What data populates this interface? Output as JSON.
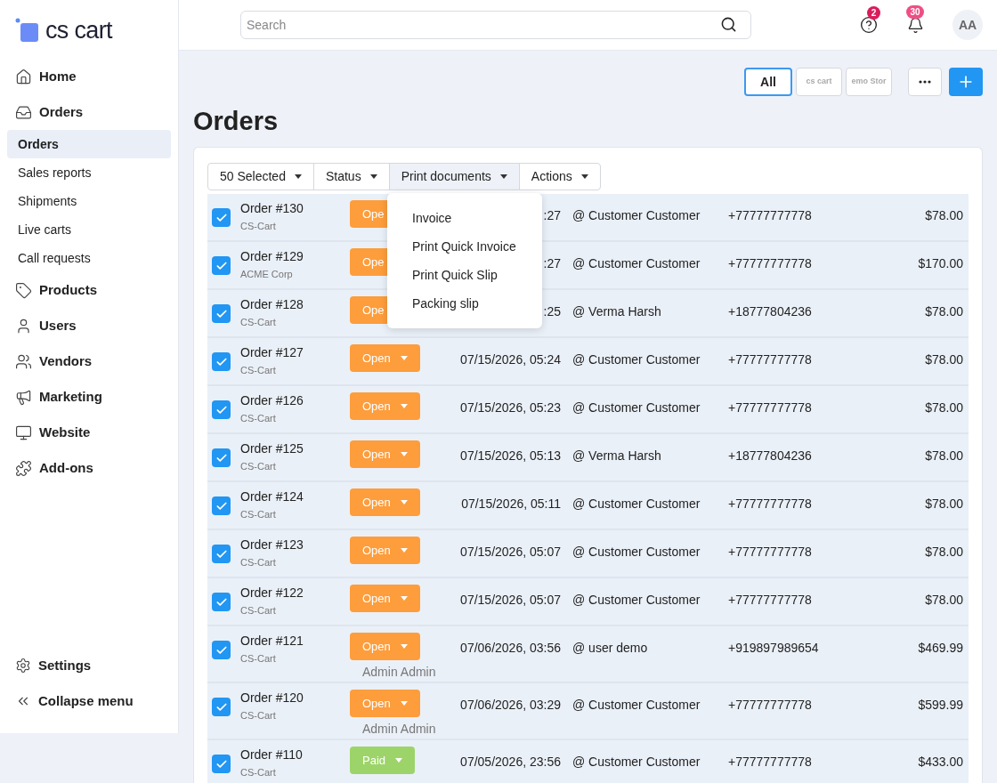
{
  "logo": {
    "text": "cs cart"
  },
  "sidebar": {
    "items": [
      {
        "label": "Home",
        "kind": "home"
      },
      {
        "label": "Orders",
        "kind": "orders",
        "children": [
          {
            "label": "Orders",
            "selected": true
          },
          {
            "label": "Sales reports",
            "selected": false
          },
          {
            "label": "Shipments",
            "selected": false
          },
          {
            "label": "Live carts",
            "selected": false
          },
          {
            "label": "Call requests",
            "selected": false
          }
        ]
      },
      {
        "label": "Products",
        "kind": "products"
      },
      {
        "label": "Users",
        "kind": "users"
      },
      {
        "label": "Vendors",
        "kind": "vendors"
      },
      {
        "label": "Marketing",
        "kind": "marketing"
      },
      {
        "label": "Website",
        "kind": "website"
      },
      {
        "label": "Add-ons",
        "kind": "addons"
      }
    ],
    "bottom": [
      {
        "label": "Settings",
        "kind": "settings"
      },
      {
        "label": "Collapse menu",
        "kind": "collapse"
      }
    ]
  },
  "header": {
    "search": {
      "placeholder": "Search"
    },
    "help_badge": "2",
    "notifications_badge": "30",
    "avatar": "AA"
  },
  "storefronts": [
    {
      "label": "All",
      "selected": true
    },
    {
      "label": "cs cart",
      "selected": false
    },
    {
      "label": "emo Stor",
      "selected": false
    }
  ],
  "page_title": "Orders",
  "toolbar": [
    {
      "label": "50 Selected",
      "open": false
    },
    {
      "label": "Status",
      "open": false
    },
    {
      "label": "Print documents",
      "open": true
    },
    {
      "label": "Actions",
      "open": false
    }
  ],
  "print_menu": [
    "Invoice",
    "Print Quick Invoice",
    "Print Quick Slip",
    "Packing slip"
  ],
  "orders": [
    {
      "order": "Order #130",
      "store": "CS-Cart",
      "status": "Ope",
      "kind": "open",
      "covered": true,
      "date": ":27",
      "customer": "@ Customer Customer",
      "phone": "+77777777778",
      "total": "$78.00",
      "checked": true
    },
    {
      "order": "Order #129",
      "store": "ACME Corp",
      "status": "Ope",
      "kind": "open",
      "covered": true,
      "date": ":27",
      "customer": "@ Customer Customer",
      "phone": "+77777777778",
      "total": "$170.00",
      "checked": true
    },
    {
      "order": "Order #128",
      "store": "CS-Cart",
      "status": "Ope",
      "kind": "open",
      "covered": true,
      "date": ":25",
      "customer": "@ Verma Harsh",
      "phone": "+18777804236",
      "total": "$78.00",
      "checked": true
    },
    {
      "order": "Order #127",
      "store": "CS-Cart",
      "status": "Open",
      "kind": "open",
      "covered": false,
      "date": "07/15/2026, 05:24",
      "customer": "@ Customer Customer",
      "phone": "+77777777778",
      "total": "$78.00",
      "checked": true
    },
    {
      "order": "Order #126",
      "store": "CS-Cart",
      "status": "Open",
      "kind": "open",
      "covered": false,
      "date": "07/15/2026, 05:23",
      "customer": "@ Customer Customer",
      "phone": "+77777777778",
      "total": "$78.00",
      "checked": true
    },
    {
      "order": "Order #125",
      "store": "CS-Cart",
      "status": "Open",
      "kind": "open",
      "covered": false,
      "date": "07/15/2026, 05:13",
      "customer": "@ Verma Harsh",
      "phone": "+18777804236",
      "total": "$78.00",
      "checked": true
    },
    {
      "order": "Order #124",
      "store": "CS-Cart",
      "status": "Open",
      "kind": "open",
      "covered": false,
      "date": "07/15/2026, 05:11",
      "customer": "@ Customer Customer",
      "phone": "+77777777778",
      "total": "$78.00",
      "checked": true
    },
    {
      "order": "Order #123",
      "store": "CS-Cart",
      "status": "Open",
      "kind": "open",
      "covered": false,
      "date": "07/15/2026, 05:07",
      "customer": "@ Customer Customer",
      "phone": "+77777777778",
      "total": "$78.00",
      "checked": true
    },
    {
      "order": "Order #122",
      "store": "CS-Cart",
      "status": "Open",
      "kind": "open",
      "covered": false,
      "date": "07/15/2026, 05:07",
      "customer": "@ Customer Customer",
      "phone": "+77777777778",
      "total": "$78.00",
      "checked": true
    },
    {
      "order": "Order #121",
      "store": "CS-Cart",
      "status": "Open",
      "kind": "open",
      "covered": false,
      "assignee": "Admin Admin",
      "date": "07/06/2026, 03:56",
      "customer": "@ user demo",
      "phone": "+919897989654",
      "total": "$469.99",
      "checked": true
    },
    {
      "order": "Order #120",
      "store": "CS-Cart",
      "status": "Open",
      "kind": "open",
      "covered": false,
      "assignee": "Admin Admin",
      "date": "07/06/2026, 03:29",
      "customer": "@ Customer Customer",
      "phone": "+77777777778",
      "total": "$599.99",
      "checked": true
    },
    {
      "order": "Order #110",
      "store": "CS-Cart",
      "status": "Paid",
      "kind": "paid",
      "covered": false,
      "date": "07/05/2026, 23:56",
      "customer": "@ Customer Customer",
      "phone": "+77777777778",
      "total": "$433.00",
      "checked": true
    }
  ]
}
